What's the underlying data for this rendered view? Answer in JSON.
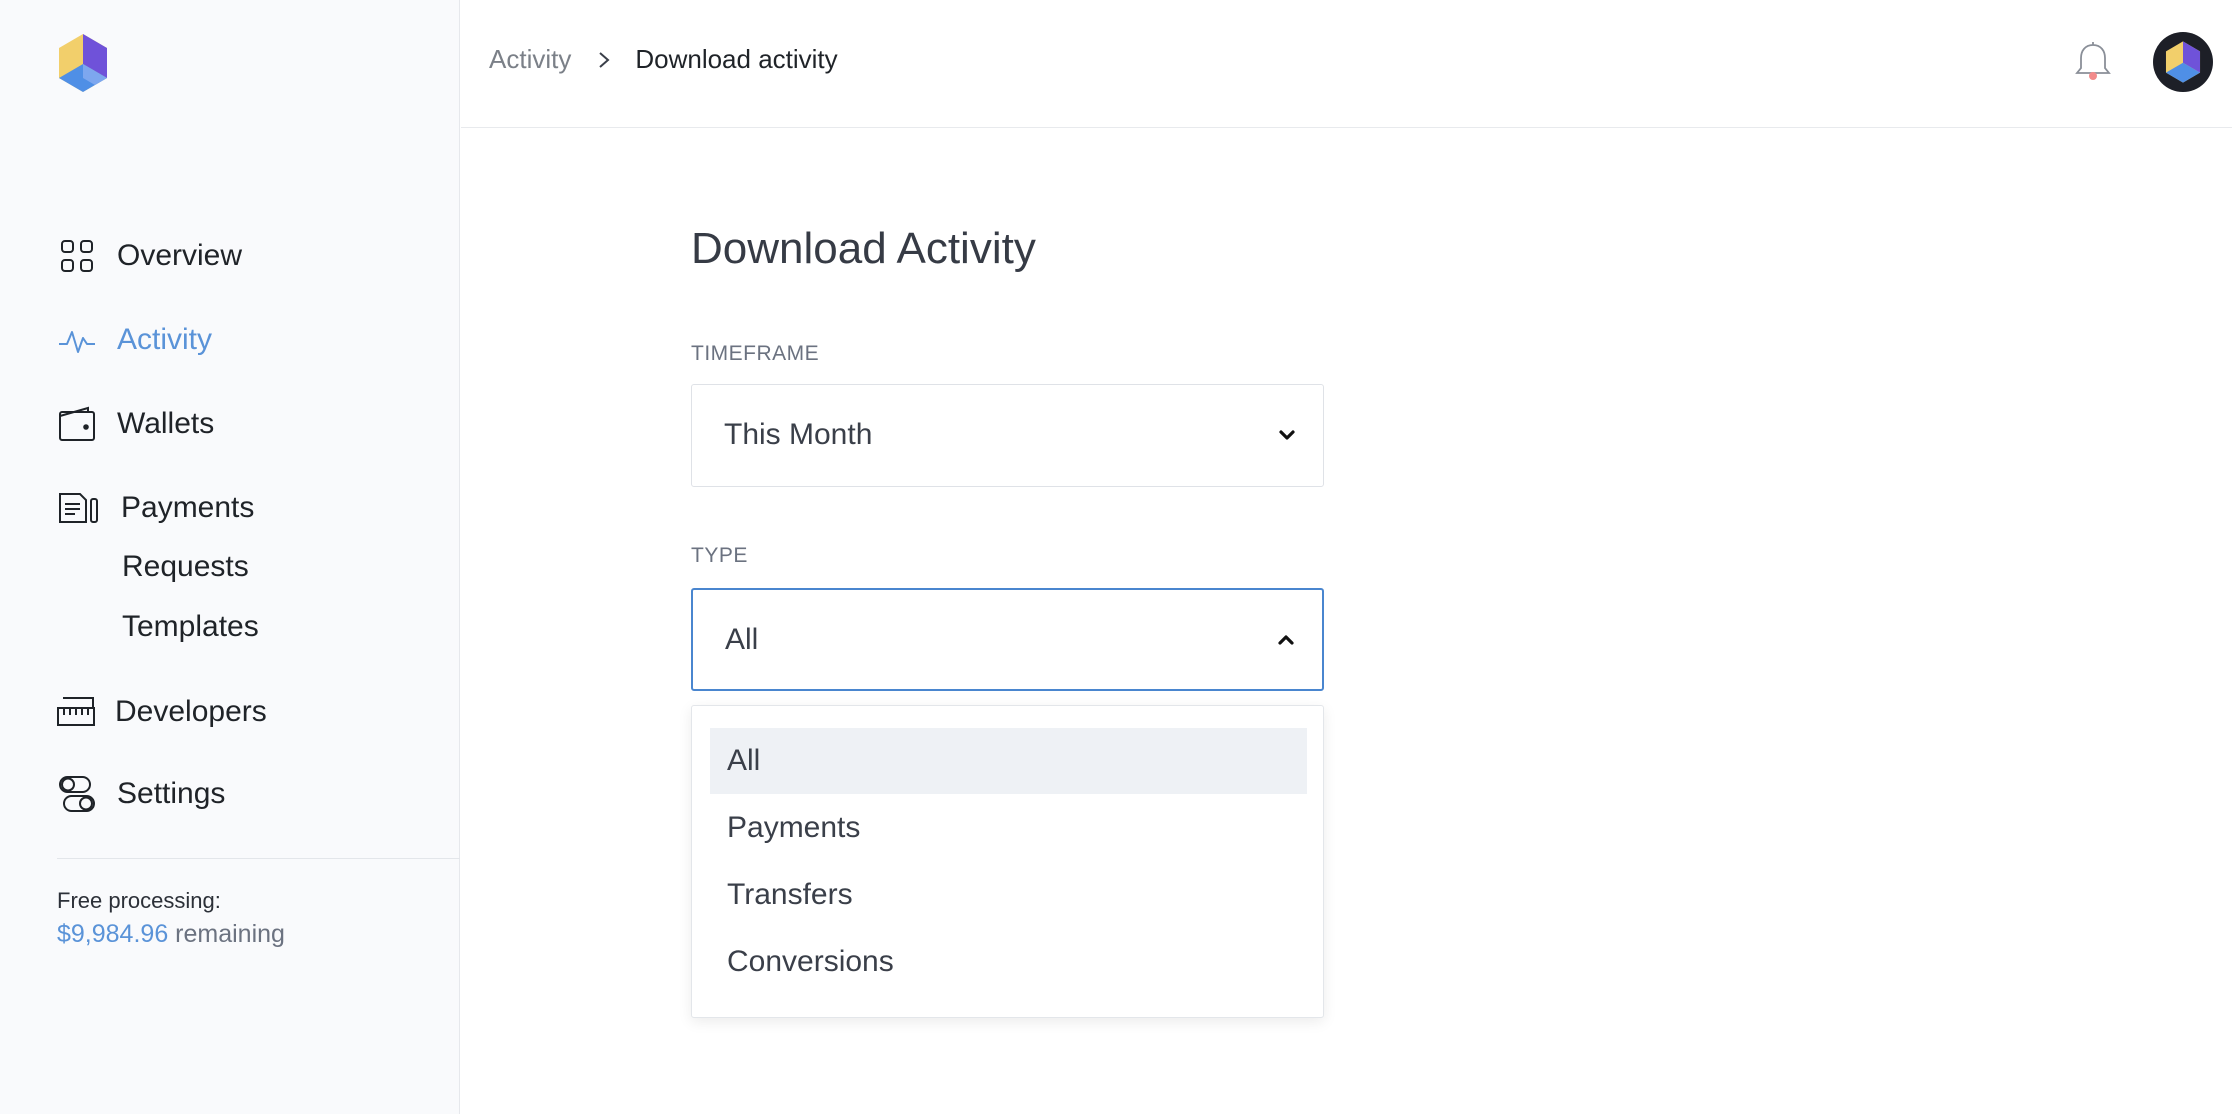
{
  "brand": {
    "logo_icon": "hexagon-cube-logo-icon",
    "colors": {
      "accent": "#5a93d8",
      "logo_yellow": "#f2cf6b",
      "logo_purple": "#6f52d9",
      "logo_blue": "#4f8fe6"
    }
  },
  "sidebar": {
    "items": [
      {
        "label": "Overview",
        "icon": "grid-icon"
      },
      {
        "label": "Activity",
        "icon": "pulse-icon",
        "active": true
      },
      {
        "label": "Wallets",
        "icon": "wallet-icon"
      },
      {
        "label": "Payments",
        "icon": "invoice-icon"
      },
      {
        "label": "Developers",
        "icon": "ruler-icon"
      },
      {
        "label": "Settings",
        "icon": "toggles-icon"
      }
    ],
    "payments_sub": [
      "Requests",
      "Templates"
    ],
    "free_processing": {
      "label": "Free processing:",
      "amount": "$9,984.96",
      "suffix": "remaining"
    }
  },
  "header": {
    "breadcrumb": {
      "parent": "Activity",
      "current": "Download activity"
    },
    "bell_icon": "bell-icon",
    "avatar_icon": "avatar-icon"
  },
  "main": {
    "title": "Download Activity",
    "timeframe": {
      "label": "TIMEFRAME",
      "value": "This Month"
    },
    "type": {
      "label": "TYPE",
      "value": "All",
      "options": [
        "All",
        "Payments",
        "Transfers",
        "Conversions"
      ],
      "selected_index": 0
    }
  }
}
